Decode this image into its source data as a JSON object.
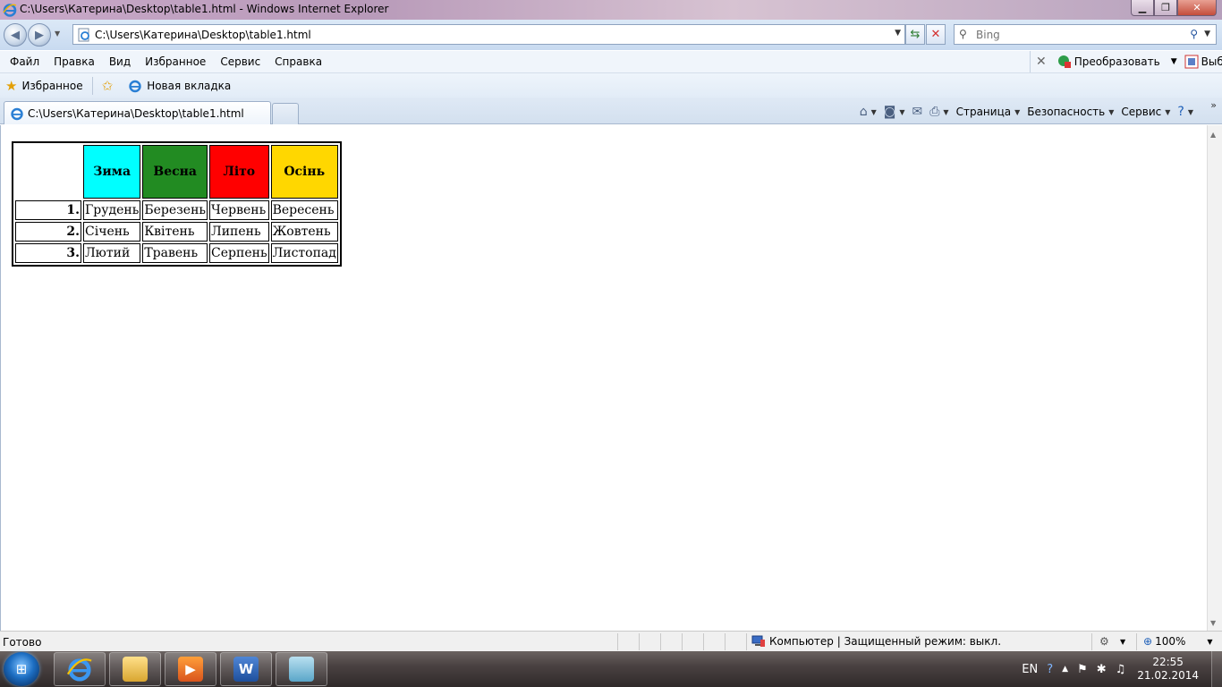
{
  "window": {
    "title": "C:\\Users\\Катерина\\Desktop\\table1.html - Windows Internet Explorer"
  },
  "address": {
    "url": "C:\\Users\\Катерина\\Desktop\\table1.html",
    "search_placeholder": "Bing"
  },
  "menu": {
    "items": [
      "Файл",
      "Правка",
      "Вид",
      "Избранное",
      "Сервис",
      "Справка"
    ],
    "convert_label": "Преобразовать",
    "select_label": "Выбр"
  },
  "favorites": {
    "favorites_label": "Избранное",
    "new_tab_label": "Новая вкладка"
  },
  "tab": {
    "title": "C:\\Users\\Катерина\\Desktop\\table1.html"
  },
  "commands": {
    "page": "Страница",
    "safety": "Безопасность",
    "tools": "Сервис"
  },
  "table": {
    "headers": [
      {
        "label": "Зима",
        "color": "#00ffff"
      },
      {
        "label": "Весна",
        "color": "#228b22"
      },
      {
        "label": "Літо",
        "color": "#ff0000"
      },
      {
        "label": "Осінь",
        "color": "#ffd700"
      }
    ],
    "rows": [
      {
        "num": "1.",
        "cells": [
          "Грудень",
          "Березень",
          "Червень",
          "Вересень"
        ]
      },
      {
        "num": "2.",
        "cells": [
          "Січень",
          "Квітень",
          "Липень",
          "Жовтень"
        ]
      },
      {
        "num": "3.",
        "cells": [
          "Лютий",
          "Травень",
          "Серпень",
          "Листопад"
        ]
      }
    ]
  },
  "status": {
    "text": "Готово",
    "zone": "Компьютер | Защищенный режим: выкл.",
    "zoom": "100%"
  },
  "taskbar": {
    "lang": "EN",
    "time": "22:55",
    "date": "21.02.2014"
  }
}
